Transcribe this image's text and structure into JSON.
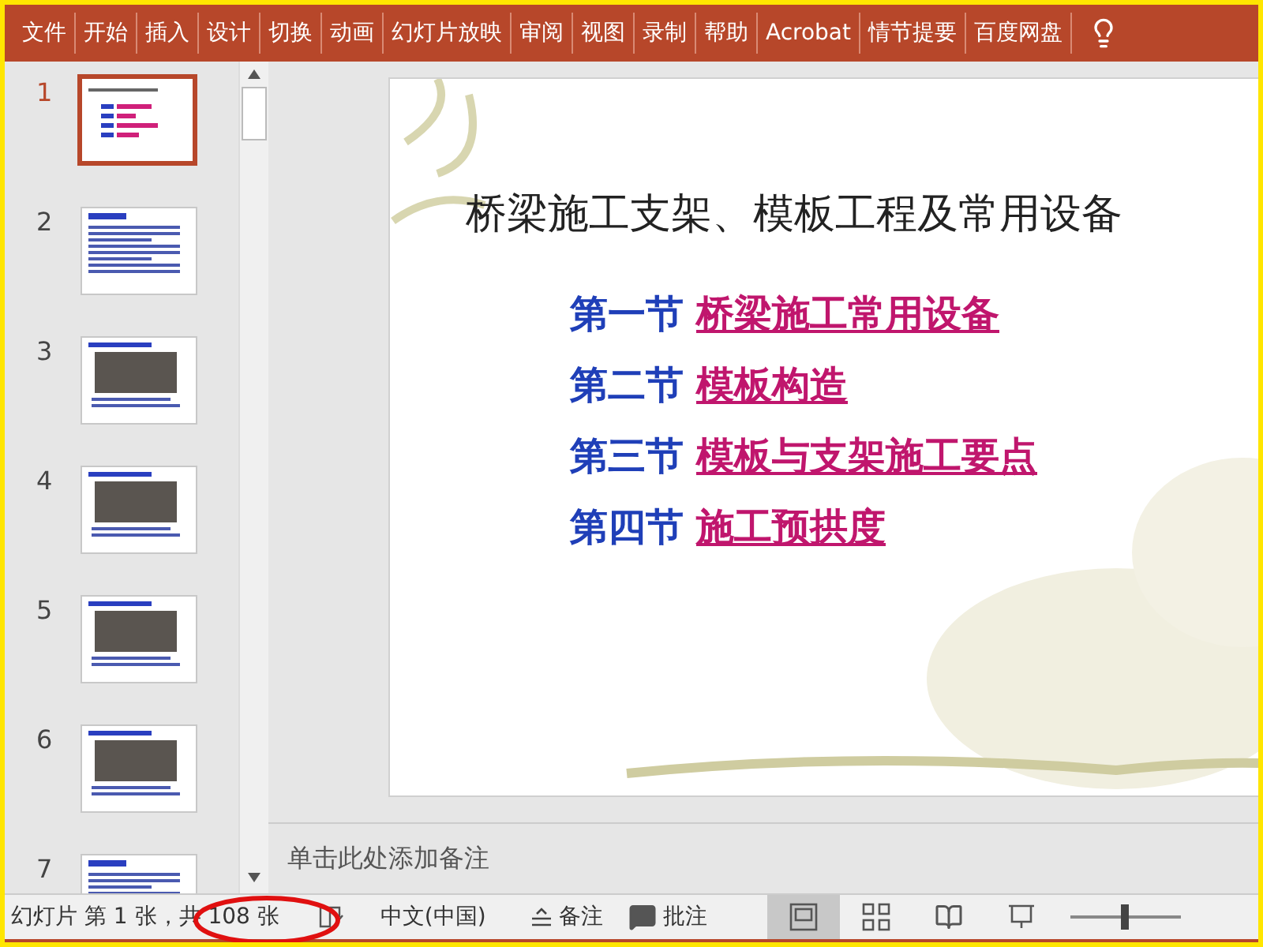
{
  "ribbon": {
    "tabs": [
      {
        "label": "文件"
      },
      {
        "label": "开始"
      },
      {
        "label": "插入"
      },
      {
        "label": "设计"
      },
      {
        "label": "切换"
      },
      {
        "label": "动画"
      },
      {
        "label": "幻灯片放映"
      },
      {
        "label": "审阅"
      },
      {
        "label": "视图"
      },
      {
        "label": "录制"
      },
      {
        "label": "帮助"
      },
      {
        "label": "Acrobat"
      },
      {
        "label": "情节提要"
      },
      {
        "label": "百度网盘"
      }
    ]
  },
  "thumbnails": [
    {
      "number": "1",
      "kind": "title",
      "selected": true
    },
    {
      "number": "2",
      "kind": "text",
      "selected": false
    },
    {
      "number": "3",
      "kind": "photo",
      "selected": false
    },
    {
      "number": "4",
      "kind": "photo",
      "selected": false
    },
    {
      "number": "5",
      "kind": "photo",
      "selected": false
    },
    {
      "number": "6",
      "kind": "photo",
      "selected": false
    },
    {
      "number": "7",
      "kind": "text",
      "selected": false
    }
  ],
  "slide": {
    "title": "桥梁施工支架、模板工程及常用设备",
    "sections": [
      {
        "label": "第一节",
        "link": "桥梁施工常用设备"
      },
      {
        "label": "第二节",
        "link": "模板构造"
      },
      {
        "label": "第三节",
        "link": "模板与支架施工要点"
      },
      {
        "label": "第四节",
        "link": "施工预拱度"
      }
    ]
  },
  "notes": {
    "placeholder": "单击此处添加备注"
  },
  "status_bar": {
    "slide_info": "幻灯片 第 1 张，共 108 张",
    "language": "中文(中国)",
    "notes": "备注",
    "comments": "批注",
    "views": [
      {
        "kind": "normal",
        "selected": true
      },
      {
        "kind": "sorter",
        "selected": false
      },
      {
        "kind": "reading",
        "selected": false
      },
      {
        "kind": "slideshow",
        "selected": false
      }
    ],
    "zoom": {
      "level": 0.5
    }
  }
}
